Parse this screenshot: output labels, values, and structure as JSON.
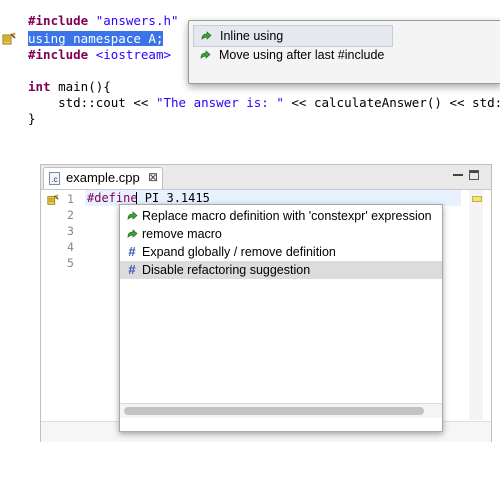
{
  "top_code": {
    "line1_kw": "#include",
    "line1_str": "\"answers.h\"",
    "line2_sel": "using namespace A;",
    "line3_kw": "#include",
    "line3_str": "<iostream>",
    "line5_kw": "int",
    "line5_rest": " main(){",
    "line6_a": "    std::cout << ",
    "line6_str": "\"The answer is: \"",
    "line6_b": " << calculateAnswer() << std::",
    "line7": "}"
  },
  "top_quickfix": {
    "items": [
      {
        "label": "Inline using",
        "highlighted": true
      },
      {
        "label": "Move using after last #include",
        "highlighted": false
      }
    ]
  },
  "editor": {
    "tab_label": "example.cpp",
    "file_icon": "c-file-icon",
    "line_numbers": [
      "1",
      "2",
      "3",
      "4",
      "5"
    ],
    "code_directive": "#define",
    "code_rest": " PI 3.1415"
  },
  "quickfix": {
    "items": [
      {
        "label": "Replace macro definition with 'constexpr' expression",
        "icon": "green-arrow-icon",
        "highlighted": false
      },
      {
        "label": "remove macro",
        "icon": "green-arrow-icon",
        "highlighted": false
      },
      {
        "label": "Expand globally / remove definition",
        "icon": "hash-icon",
        "highlighted": false
      },
      {
        "label": "Disable refactoring suggestion",
        "icon": "hash-icon",
        "highlighted": true
      }
    ]
  },
  "colors": {
    "keyword": "#7f0055",
    "string": "#2a00ff",
    "selection": "#3a74e8",
    "current_line": "#e8f2fe"
  }
}
